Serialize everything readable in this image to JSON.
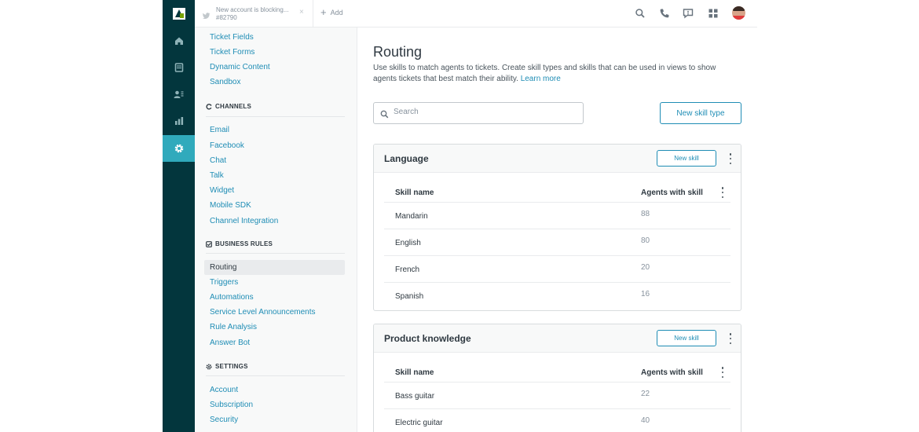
{
  "topbar": {
    "tab": {
      "line1": "New account is blocking...",
      "line2": "#82790",
      "close": "×"
    },
    "add_label": "Add",
    "icons": [
      "search-icon",
      "phone-icon",
      "chat-icon",
      "apps-grid-icon",
      "user-avatar"
    ]
  },
  "rail": {
    "icons": [
      "zendesk-logo",
      "home-icon",
      "views-icon",
      "customers-icon",
      "reporting-icon",
      "admin-gear-icon"
    ],
    "active": "admin-gear-icon",
    "active_color": "#30aabc",
    "background": "#03363d"
  },
  "sidebar": {
    "top_items": [
      "Ticket Fields",
      "Ticket Forms",
      "Dynamic Content",
      "Sandbox"
    ],
    "channels": {
      "heading": "CHANNELS",
      "items": [
        "Email",
        "Facebook",
        "Chat",
        "Talk",
        "Widget",
        "Mobile SDK",
        "Channel Integration"
      ]
    },
    "business_rules": {
      "heading": "BUSINESS RULES",
      "items": [
        "Routing",
        "Triggers",
        "Automations",
        "Service Level Announcements",
        "Rule Analysis",
        "Answer Bot"
      ]
    },
    "settings": {
      "heading": "SETTINGS",
      "items": [
        "Account",
        "Subscription",
        "Security"
      ]
    }
  },
  "main": {
    "title": "Routing",
    "description": "Use skills to match agents to tickets. Create skill types and skills that can be used in views to show agents tickets that best match their ability.",
    "learn_more": "Learn more",
    "search_placeholder": "Search",
    "new_skill_type_label": "New skill type",
    "skill_types": [
      {
        "name": "Language",
        "new_skill_label": "New skill",
        "col_skill": "Skill name",
        "col_agents": "Agents with skill",
        "skills": [
          {
            "name": "Mandarin",
            "agents": "88"
          },
          {
            "name": "English",
            "agents": "80"
          },
          {
            "name": "French",
            "agents": "20"
          },
          {
            "name": "Spanish",
            "agents": "16"
          }
        ]
      },
      {
        "name": "Product knowledge",
        "new_skill_label": "New skill",
        "col_skill": "Skill name",
        "col_agents": "Agents with skill",
        "skills": [
          {
            "name": "Bass guitar",
            "agents": "22"
          },
          {
            "name": "Electric guitar",
            "agents": "40"
          }
        ]
      }
    ]
  },
  "colors": {
    "link": "#1f8db5",
    "accent": "#30aabc",
    "rail": "#03363d"
  }
}
